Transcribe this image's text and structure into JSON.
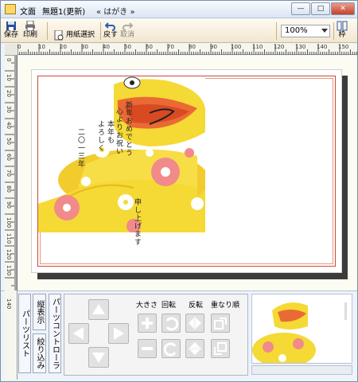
{
  "title": {
    "doc": "文面",
    "name": "無題1(更新)",
    "format": "« はがき »"
  },
  "toolbar": {
    "save": "保存",
    "print": "印刷",
    "paper": "用紙選択",
    "undo": "戻す",
    "redo": "取消",
    "zoom": "100%",
    "frame": "枠"
  },
  "ruler_h": [
    "0",
    "10",
    "20",
    "30",
    "40",
    "50",
    "60",
    "70",
    "80",
    "90",
    "100",
    "110",
    "120",
    "130",
    "140",
    "150"
  ],
  "ruler_v": [
    "0",
    "10",
    "20",
    "30",
    "40",
    "50",
    "60",
    "70",
    "80",
    "90",
    "100",
    "110",
    "120",
    "130",
    "140"
  ],
  "card_text": {
    "col1": "新年おめでとう",
    "col2": "心よりお祝い",
    "col3": "本年も",
    "col4": "よろしく",
    "col5": "二〇一三年",
    "col6": "申し上げます"
  },
  "side_tabs": {
    "parts_list": "パーツリスト",
    "show_vertical": "縦表示",
    "filter": "絞り込み",
    "parts_controller": "パーツコントローラ"
  },
  "panel": {
    "size": "大きさ",
    "rotate": "回転",
    "flip": "反転",
    "order": "重なり順"
  },
  "colors": {
    "accent": "#c94a36",
    "yellow": "#f5d935",
    "orange": "#ea6a35",
    "pink": "#f08b8a"
  }
}
